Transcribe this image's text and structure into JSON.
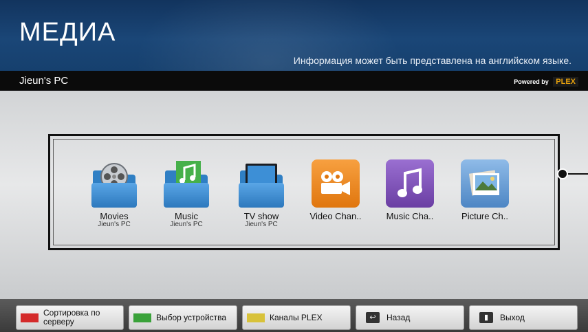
{
  "header": {
    "title": "МЕДИА",
    "info": "Информация может быть представлена на английском языке."
  },
  "subbar": {
    "pc_name": "Jieun's PC",
    "powered_by": "Powered by",
    "plex": "PLEX"
  },
  "tiles": [
    {
      "name": "Movies",
      "sub": "Jieun's PC",
      "icon": "movies-folder-icon"
    },
    {
      "name": "Music",
      "sub": "Jieun's PC",
      "icon": "music-folder-icon"
    },
    {
      "name": "TV show",
      "sub": "Jieun's PC",
      "icon": "tv-folder-icon"
    },
    {
      "name": "Video Chan..",
      "sub": "",
      "icon": "video-camera-icon",
      "color": "#f08a1c"
    },
    {
      "name": "Music Cha..",
      "sub": "",
      "icon": "music-note-icon",
      "color": "#7a4fb3"
    },
    {
      "name": "Picture Ch..",
      "sub": "",
      "icon": "picture-icon",
      "color": "#6ea1d8"
    }
  ],
  "footer": {
    "sort_label": "Сортировка по серверу",
    "device_label": "Выбор устройства",
    "plex_channels_label": "Каналы PLEX",
    "back_label": "Назад",
    "exit_label": "Выход"
  },
  "colors": {
    "red_key": "#d42a2a",
    "green_key": "#3aa23a",
    "yellow_key": "#d8c23a",
    "header_blue": "#1a4677"
  }
}
